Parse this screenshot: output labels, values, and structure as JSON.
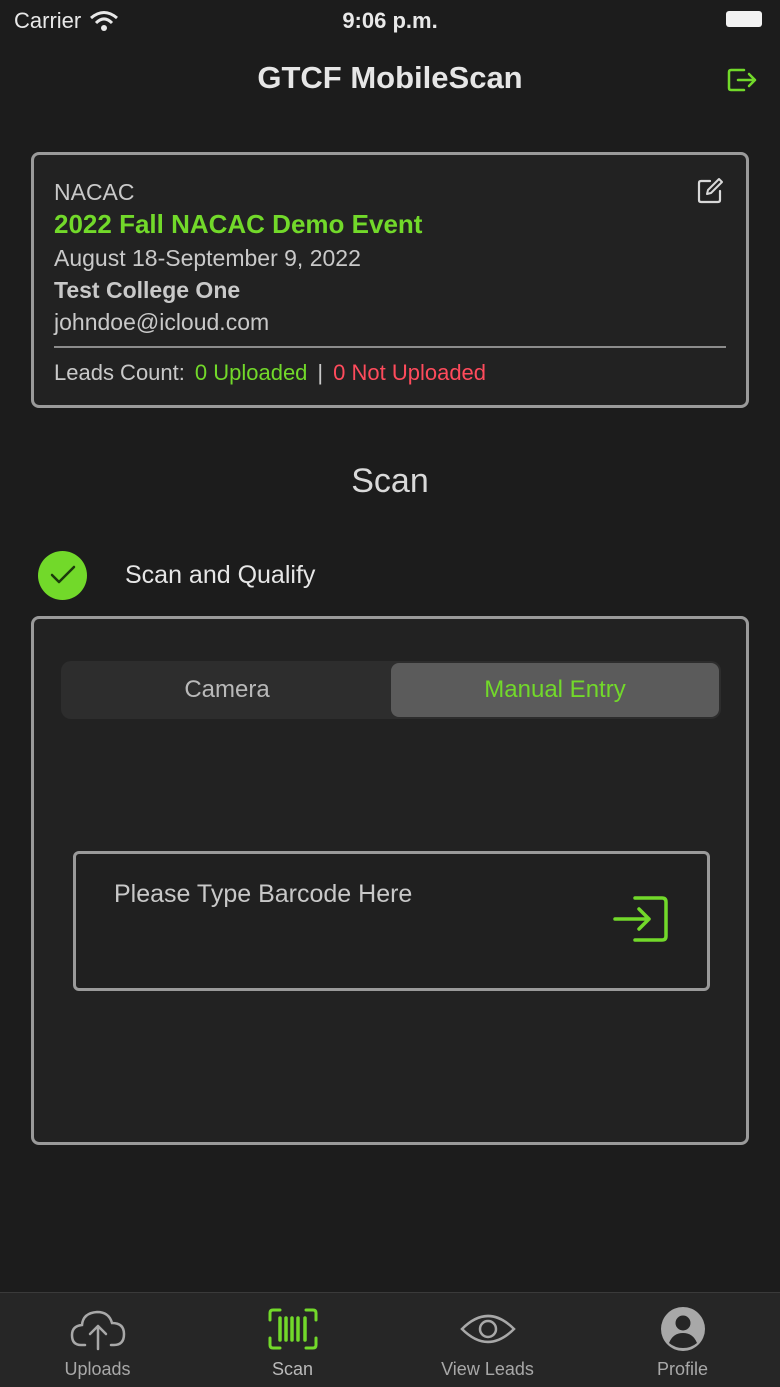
{
  "status_bar": {
    "carrier": "Carrier",
    "time": "9:06 p.m."
  },
  "nav": {
    "title": "GTCF MobileScan"
  },
  "event": {
    "org": "NACAC",
    "name": "2022 Fall NACAC Demo Event",
    "dates": "August 18-September 9, 2022",
    "college": "Test College One",
    "email": "johndoe@icloud.com",
    "leads_label": "Leads Count:",
    "uploaded": "0 Uploaded",
    "separator": "|",
    "not_uploaded": "0 Not Uploaded"
  },
  "scan": {
    "title": "Scan",
    "qualify_label": "Scan and Qualify",
    "qualify_checked": true,
    "segments": {
      "camera": "Camera",
      "manual": "Manual Entry"
    },
    "selected_segment": "Manual Entry",
    "barcode_placeholder": "Please Type Barcode Here",
    "barcode_value": ""
  },
  "tabs": [
    {
      "label": "Uploads",
      "icon": "cloud-upload-icon"
    },
    {
      "label": "Scan",
      "icon": "barcode-icon",
      "active": true
    },
    {
      "label": "View Leads",
      "icon": "eye-icon"
    },
    {
      "label": "Profile",
      "icon": "profile-icon"
    }
  ],
  "colors": {
    "accent": "#72d92a",
    "danger": "#ff4b5c",
    "background": "#1c1c1c"
  }
}
